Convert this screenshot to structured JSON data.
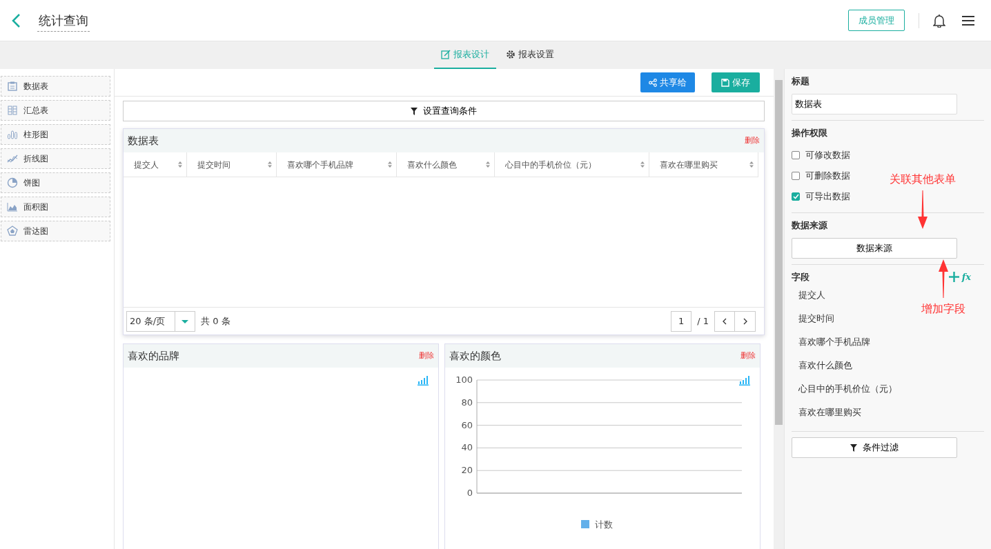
{
  "header": {
    "title": "统计查询",
    "member_button": "成员管理"
  },
  "tabs": [
    {
      "label": "报表设计",
      "selected": true,
      "kind": "design"
    },
    {
      "label": "报表设置",
      "selected": false,
      "kind": "settings"
    }
  ],
  "widgets": [
    {
      "label": "数据表",
      "kind": "table"
    },
    {
      "label": "汇总表",
      "kind": "summary"
    },
    {
      "label": "柱形图",
      "kind": "bar"
    },
    {
      "label": "折线图",
      "kind": "line"
    },
    {
      "label": "饼图",
      "kind": "pie"
    },
    {
      "label": "面积图",
      "kind": "area"
    },
    {
      "label": "雷达图",
      "kind": "radar"
    }
  ],
  "toolbar": {
    "share_button": "共享给",
    "save_button": "保存"
  },
  "query_button": "设置查询条件",
  "table_card": {
    "title": "数据表",
    "delete": "删除",
    "columns": [
      "提交人",
      "提交时间",
      "喜欢哪个手机品牌",
      "喜欢什么颜色",
      "心目中的手机价位（元）",
      "喜欢在哪里购买"
    ],
    "page_size": "20 条/页",
    "total": "共 0 条",
    "page": "1",
    "page_count": "/ 1"
  },
  "chart_cards": [
    {
      "title": "喜欢的品牌",
      "delete": "删除"
    },
    {
      "title": "喜欢的颜色",
      "delete": "删除",
      "chart_data": {
        "type": "bar",
        "series": [
          {
            "name": "计数",
            "color": "#63b0ea"
          }
        ],
        "grid": true,
        "ylim": [
          0,
          100
        ],
        "yticks": [
          0,
          20,
          40,
          60,
          80,
          100
        ]
      }
    }
  ],
  "properties": {
    "title_label": "标题",
    "title_value": "数据表",
    "permissions_label": "操作权限",
    "permissions": [
      {
        "label": "可修改数据",
        "checked": false
      },
      {
        "label": "可删除数据",
        "checked": false
      },
      {
        "label": "可导出数据",
        "checked": true
      }
    ],
    "source_label": "数据来源",
    "source_button": "数据来源",
    "fields_label": "字段",
    "formula_button": "fx",
    "fields": [
      "提交人",
      "提交时间",
      "喜欢哪个手机品牌",
      "喜欢什么颜色",
      "心目中的手机价位（元）",
      "喜欢在哪里购买"
    ],
    "filter_button": "条件过滤"
  },
  "annotations": [
    {
      "text": "关联其他表单",
      "kind": "down"
    },
    {
      "text": "增加字段",
      "kind": "up"
    }
  ]
}
